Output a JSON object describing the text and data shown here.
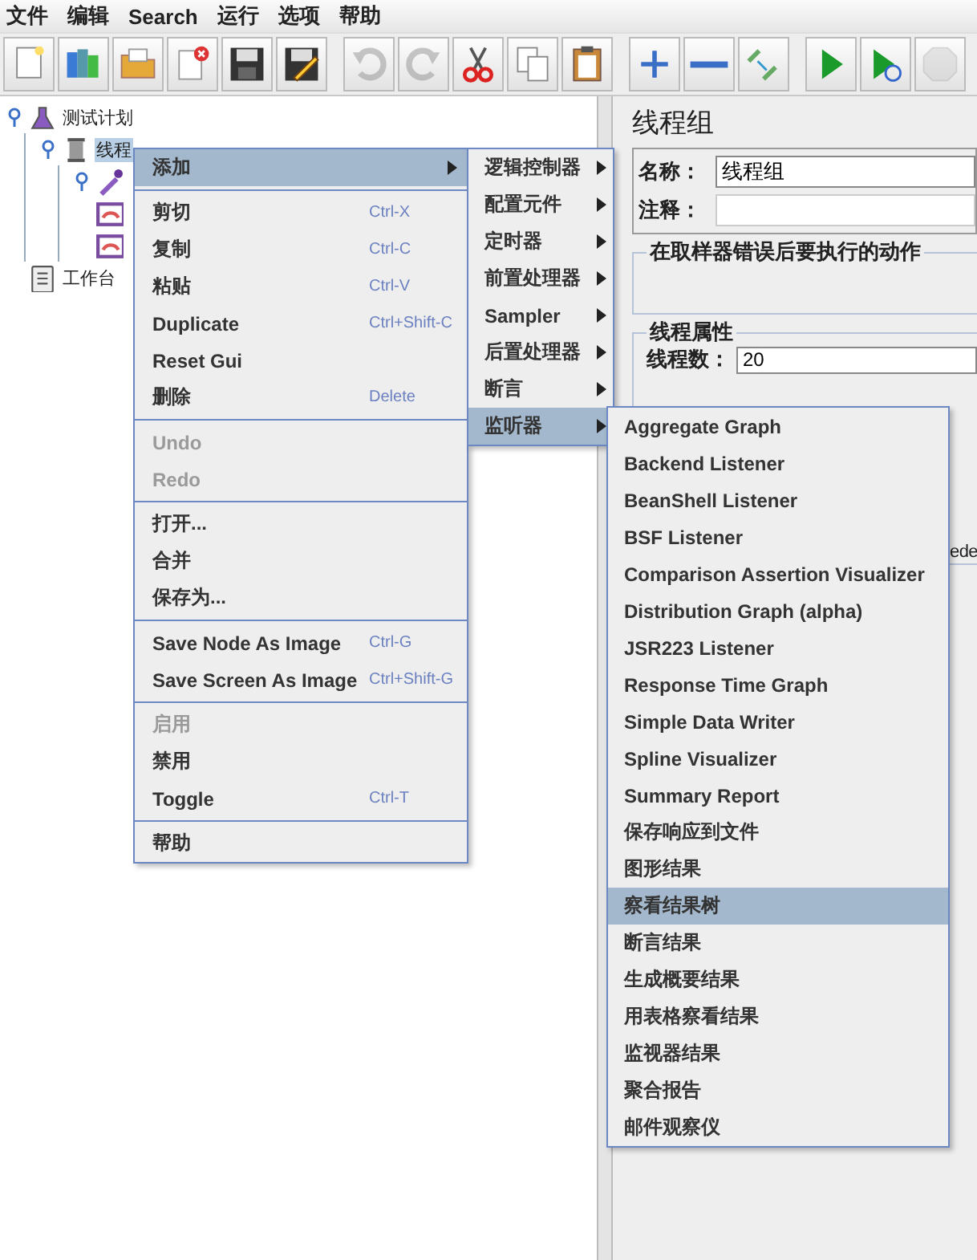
{
  "menubar": [
    "文件",
    "编辑",
    "Search",
    "运行",
    "选项",
    "帮助"
  ],
  "toolbar": {
    "groups": [
      {
        "buttons": [
          {
            "kind": "new",
            "disabled": false
          },
          {
            "kind": "templates",
            "disabled": false
          },
          {
            "kind": "open",
            "disabled": false
          },
          {
            "kind": "close",
            "disabled": false
          },
          {
            "kind": "save",
            "disabled": false
          },
          {
            "kind": "save-as",
            "disabled": false
          }
        ]
      },
      {
        "buttons": [
          {
            "kind": "undo",
            "disabled": true
          },
          {
            "kind": "redo",
            "disabled": true
          },
          {
            "kind": "cut",
            "disabled": false
          },
          {
            "kind": "copy",
            "disabled": false
          },
          {
            "kind": "paste",
            "disabled": false
          }
        ]
      },
      {
        "buttons": [
          {
            "kind": "expand",
            "disabled": false
          },
          {
            "kind": "collapse",
            "disabled": false
          },
          {
            "kind": "toggle",
            "disabled": false
          }
        ]
      },
      {
        "buttons": [
          {
            "kind": "start",
            "disabled": false
          },
          {
            "kind": "start-no-pauses",
            "disabled": false
          },
          {
            "kind": "stop",
            "disabled": true
          }
        ]
      }
    ]
  },
  "tree": [
    {
      "kind": "plan",
      "label": "测试计划",
      "selected": false,
      "expanded": true,
      "children": [
        {
          "kind": "thread-group",
          "label": "线程",
          "selected": true,
          "expanded": true,
          "children": [
            {
              "kind": "sampler",
              "selected": false,
              "expanded": true
            },
            {
              "kind": "listener",
              "selected": false,
              "expanded": false
            },
            {
              "kind": "listener",
              "selected": false,
              "expanded": false
            }
          ]
        }
      ]
    },
    {
      "kind": "workbench",
      "label": "工作台",
      "selected": false,
      "expanded": false
    }
  ],
  "detail": {
    "title": "线程组",
    "name_label": "名称：",
    "name_value": "线程组",
    "comment_label": "注释：",
    "error_group": "在取样器错误后要执行的动作",
    "props_group": "线程属性",
    "threads_label": "线程数：",
    "threads_value": "20",
    "cut_text": "ede"
  },
  "context_menu": {
    "items": [
      {
        "kind": "item",
        "label": "添加",
        "selected": true,
        "disabled": false,
        "submenu": true
      },
      {
        "kind": "separator"
      },
      {
        "kind": "item",
        "label": "剪切",
        "shortcut": "Ctrl-X",
        "selected": false,
        "disabled": false,
        "submenu": false
      },
      {
        "kind": "item",
        "label": "复制",
        "shortcut": "Ctrl-C",
        "selected": false,
        "disabled": false,
        "submenu": false
      },
      {
        "kind": "item",
        "label": "粘贴",
        "shortcut": "Ctrl-V",
        "selected": false,
        "disabled": false,
        "submenu": false
      },
      {
        "kind": "item",
        "label": "Duplicate",
        "shortcut": "Ctrl+Shift-C",
        "selected": false,
        "disabled": false,
        "submenu": false
      },
      {
        "kind": "item",
        "label": "Reset Gui",
        "selected": false,
        "disabled": false,
        "submenu": false
      },
      {
        "kind": "item",
        "label": "删除",
        "shortcut": "Delete",
        "selected": false,
        "disabled": false,
        "submenu": false
      },
      {
        "kind": "separator"
      },
      {
        "kind": "item",
        "label": "Undo",
        "selected": false,
        "disabled": true,
        "submenu": false
      },
      {
        "kind": "item",
        "label": "Redo",
        "selected": false,
        "disabled": true,
        "submenu": false
      },
      {
        "kind": "separator"
      },
      {
        "kind": "item",
        "label": "打开...",
        "selected": false,
        "disabled": false,
        "submenu": false
      },
      {
        "kind": "item",
        "label": "合并",
        "selected": false,
        "disabled": false,
        "submenu": false
      },
      {
        "kind": "item",
        "label": "保存为...",
        "selected": false,
        "disabled": false,
        "submenu": false
      },
      {
        "kind": "separator"
      },
      {
        "kind": "item",
        "label": "Save Node As Image",
        "shortcut": "Ctrl-G",
        "selected": false,
        "disabled": false,
        "submenu": false
      },
      {
        "kind": "item",
        "label": "Save Screen As Image",
        "shortcut": "Ctrl+Shift-G",
        "selected": false,
        "disabled": false,
        "submenu": false
      },
      {
        "kind": "separator"
      },
      {
        "kind": "item",
        "label": "启用",
        "selected": false,
        "disabled": true,
        "submenu": false
      },
      {
        "kind": "item",
        "label": "禁用",
        "selected": false,
        "disabled": false,
        "submenu": false
      },
      {
        "kind": "item",
        "label": "Toggle",
        "shortcut": "Ctrl-T",
        "selected": false,
        "disabled": false,
        "submenu": false
      },
      {
        "kind": "separator"
      },
      {
        "kind": "item",
        "label": "帮助",
        "selected": false,
        "disabled": false,
        "submenu": false
      }
    ]
  },
  "add_submenu": {
    "items": [
      {
        "label": "逻辑控制器",
        "selected": false,
        "submenu": true
      },
      {
        "label": "配置元件",
        "selected": false,
        "submenu": true
      },
      {
        "label": "定时器",
        "selected": false,
        "submenu": true
      },
      {
        "label": "前置处理器",
        "selected": false,
        "submenu": true
      },
      {
        "label": "Sampler",
        "selected": false,
        "submenu": true
      },
      {
        "label": "后置处理器",
        "selected": false,
        "submenu": true
      },
      {
        "label": "断言",
        "selected": false,
        "submenu": true
      },
      {
        "label": "监听器",
        "selected": true,
        "submenu": true
      }
    ]
  },
  "listener_submenu": {
    "items": [
      {
        "label": "Aggregate Graph",
        "selected": false,
        "submenu": false
      },
      {
        "label": "Backend Listener",
        "selected": false,
        "submenu": false
      },
      {
        "label": "BeanShell Listener",
        "selected": false,
        "submenu": false
      },
      {
        "label": "BSF Listener",
        "selected": false,
        "submenu": false
      },
      {
        "label": "Comparison Assertion Visualizer",
        "selected": false,
        "submenu": false
      },
      {
        "label": "Distribution Graph (alpha)",
        "selected": false,
        "submenu": false
      },
      {
        "label": "JSR223 Listener",
        "selected": false,
        "submenu": false
      },
      {
        "label": "Response Time Graph",
        "selected": false,
        "submenu": false
      },
      {
        "label": "Simple Data Writer",
        "selected": false,
        "submenu": false
      },
      {
        "label": "Spline Visualizer",
        "selected": false,
        "submenu": false
      },
      {
        "label": "Summary Report",
        "selected": false,
        "submenu": false
      },
      {
        "label": "保存响应到文件",
        "selected": false,
        "submenu": false
      },
      {
        "label": "图形结果",
        "selected": false,
        "submenu": false
      },
      {
        "label": "察看结果树",
        "selected": true,
        "submenu": false
      },
      {
        "label": "断言结果",
        "selected": false,
        "submenu": false
      },
      {
        "label": "生成概要结果",
        "selected": false,
        "submenu": false
      },
      {
        "label": "用表格察看结果",
        "selected": false,
        "submenu": false
      },
      {
        "label": "监视器结果",
        "selected": false,
        "submenu": false
      },
      {
        "label": "聚合报告",
        "selected": false,
        "submenu": false
      },
      {
        "label": "邮件观察仪",
        "selected": false,
        "submenu": false
      }
    ]
  }
}
